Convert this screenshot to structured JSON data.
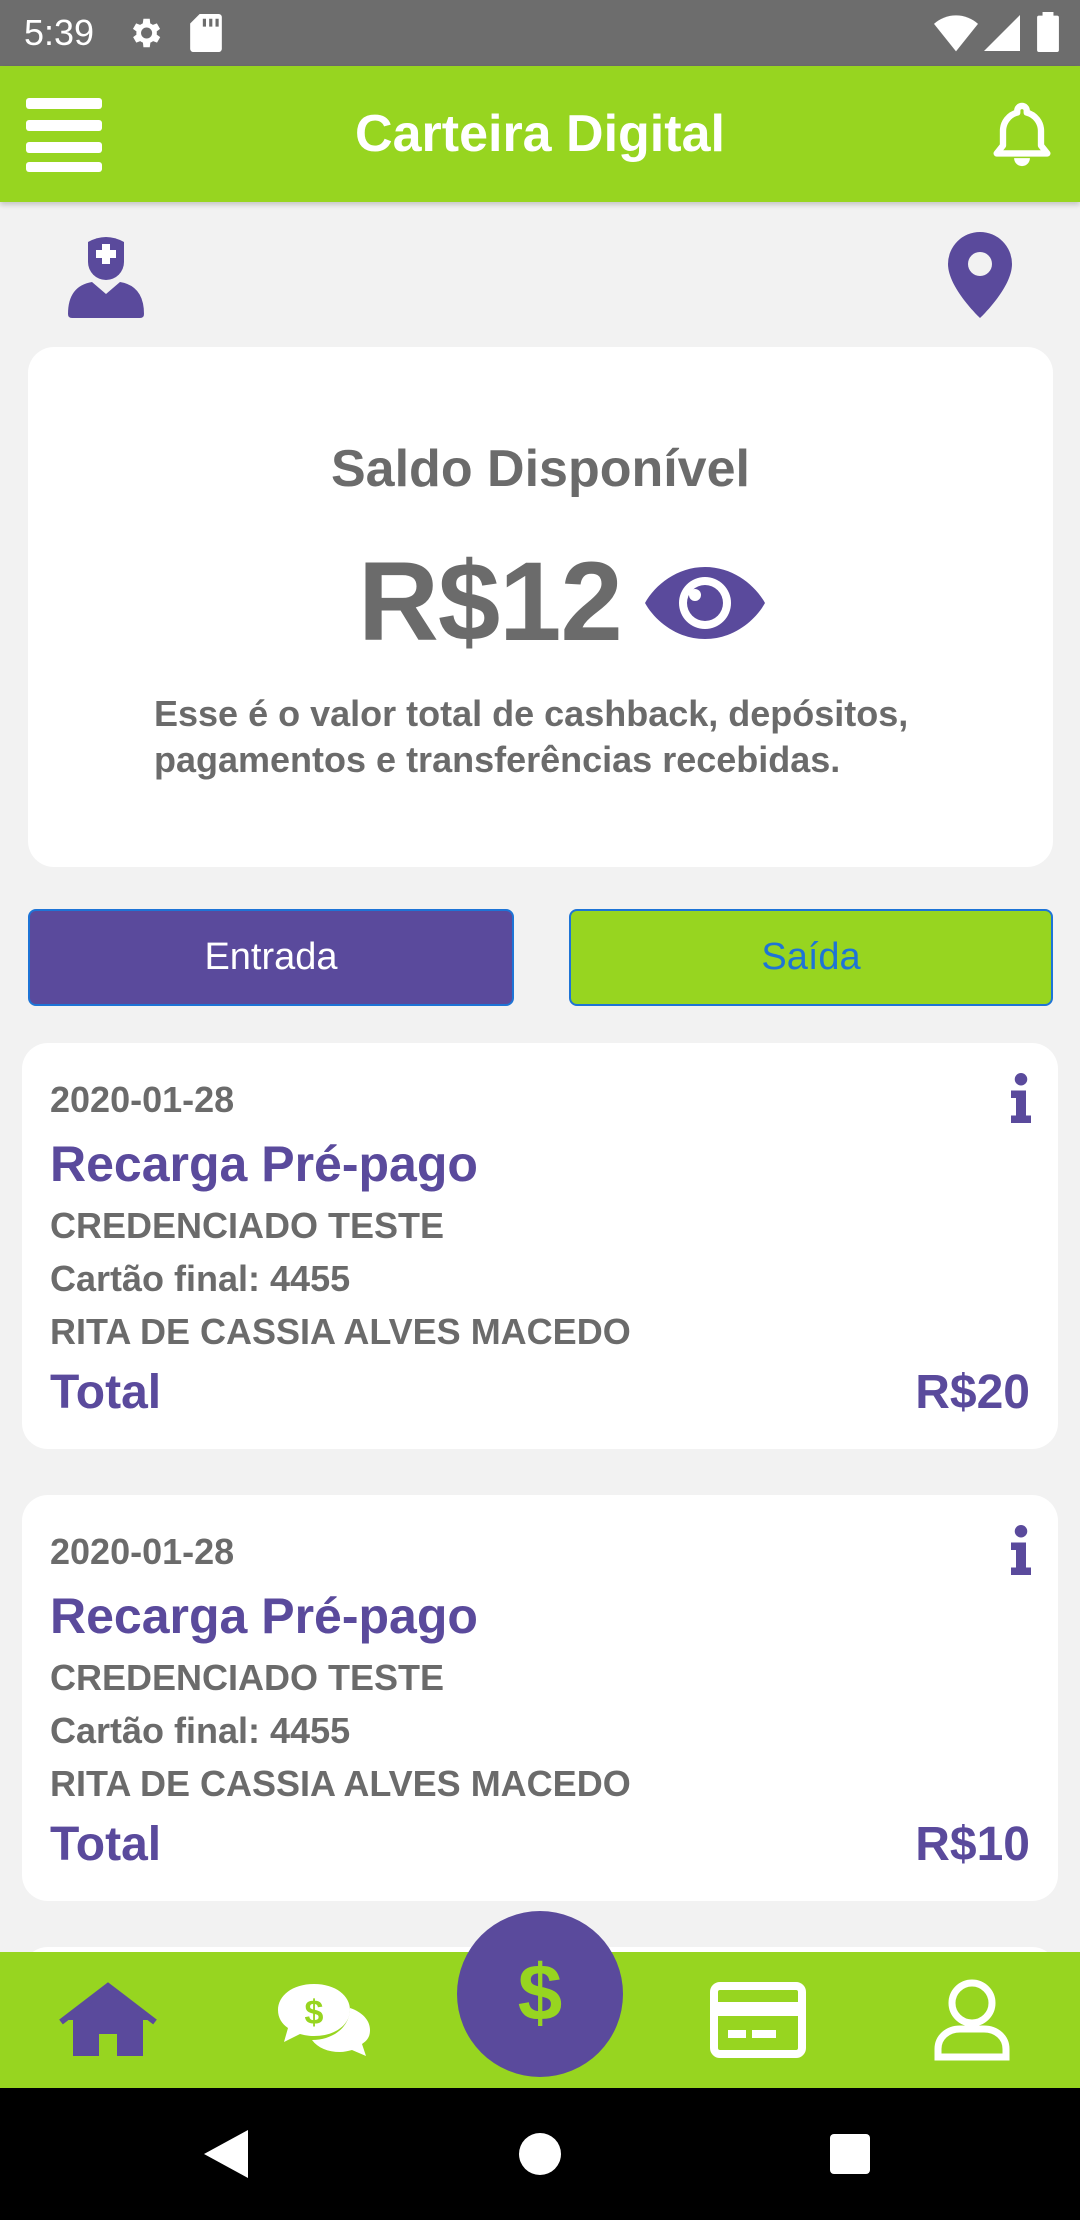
{
  "status_bar": {
    "time": "5:39",
    "icons": [
      "settings-icon",
      "sd-card-icon",
      "wifi-icon",
      "signal-icon",
      "battery-icon"
    ]
  },
  "app_bar": {
    "title": "Carteira Digital",
    "menu_icon": "hamburger-menu-icon",
    "notification_icon": "bell-icon"
  },
  "top_icons": [
    "nurse-avatar-icon",
    "location-pin-icon"
  ],
  "balance": {
    "title": "Saldo Disponível",
    "amount": "R$12",
    "description": "Esse é o valor total de cashback, depósitos, pagamentos e transferências recebidas."
  },
  "tabs": {
    "in_label": "Entrada",
    "out_label": "Saída"
  },
  "transactions": [
    {
      "date": "2020-01-28",
      "type": "Recarga Pré-pago",
      "merchant": "CREDENCIADO TESTE",
      "card": "Cartão final: 4455",
      "holder": "RITA DE CASSIA ALVES MACEDO",
      "total_label": "Total",
      "total_value": "R$20"
    },
    {
      "date": "2020-01-28",
      "type": "Recarga Pré-pago",
      "merchant": "CREDENCIADO TESTE",
      "card": "Cartão final: 4455",
      "holder": "RITA DE CASSIA ALVES MACEDO",
      "total_label": "Total",
      "total_value": "R$10"
    }
  ],
  "bottom_nav": {
    "items": [
      "home-icon",
      "chat-money-icon",
      "dollar-icon",
      "card-icon",
      "profile-icon"
    ],
    "active": "dollar-icon"
  },
  "system_nav": [
    "back-icon",
    "home-circle-icon",
    "recents-icon"
  ],
  "colors": {
    "brand_green": "#97d520",
    "brand_purple": "#5a4a9c",
    "text_gray": "#6b6b6b",
    "background": "#f2f2f2",
    "link_blue": "#1e74d6"
  }
}
